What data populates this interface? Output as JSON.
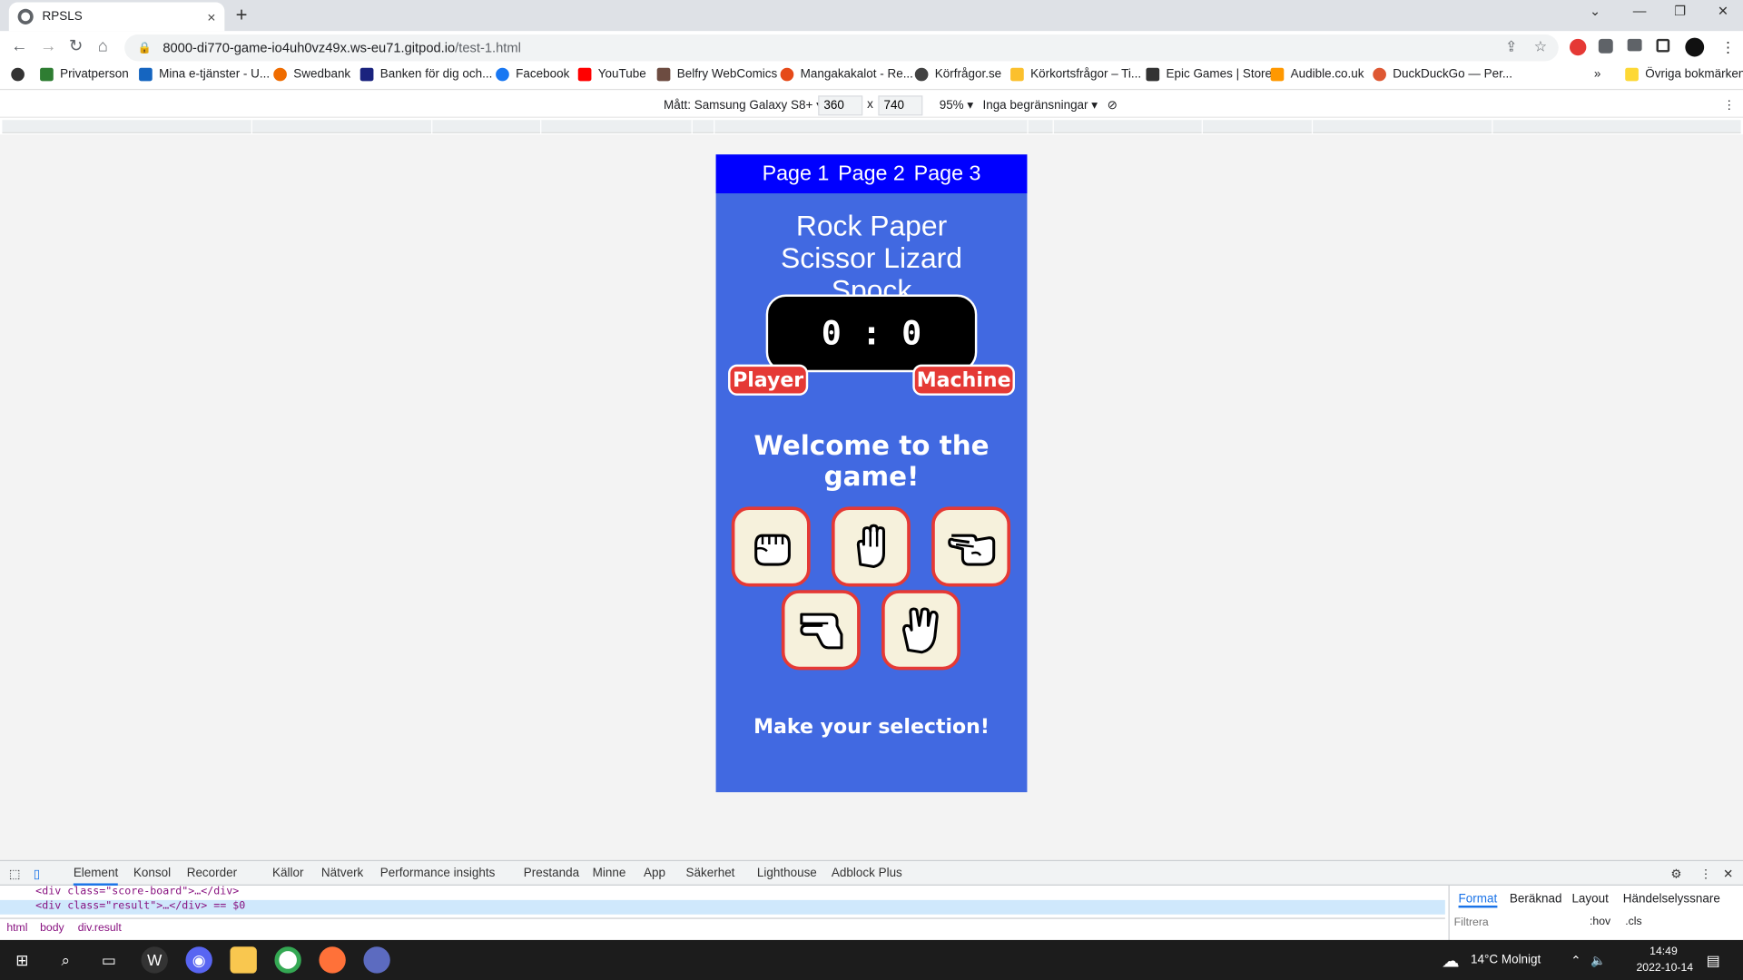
{
  "browser": {
    "tab_title": "RPSLS",
    "tab_close": "×",
    "new_tab": "+",
    "url_host": "8000-di770-game-io4uh0vz49x.ws-eu71.gitpod.io",
    "url_path": "/test-1.html"
  },
  "bookmarks": {
    "items": [
      {
        "label": "Privatperson",
        "color": "#2e7d32"
      },
      {
        "label": "Mina e-tjänster - U...",
        "color": "#1565c0"
      },
      {
        "label": "Swedbank",
        "color": "#ef6c00"
      },
      {
        "label": "Banken för dig och...",
        "color": "#1a237e"
      },
      {
        "label": "Facebook",
        "color": "#1877f2"
      },
      {
        "label": "YouTube",
        "color": "#ff0000"
      },
      {
        "label": "Belfry WebComics",
        "color": "#6d4c41"
      },
      {
        "label": "Mangakakalot - Re...",
        "color": "#e64a19"
      },
      {
        "label": "Körfrågor.se",
        "color": "#424242"
      },
      {
        "label": "Körkortsfrågor – Ti...",
        "color": "#fbc02d"
      },
      {
        "label": "Epic Games | Store",
        "color": "#333333"
      },
      {
        "label": "Audible.co.uk",
        "color": "#ff9800"
      },
      {
        "label": "DuckDuckGo — Per...",
        "color": "#de5833"
      }
    ],
    "overflow": "»",
    "other": "Övriga bokmärken"
  },
  "device_toolbar": {
    "device": "Mått: Samsung Galaxy S8+",
    "width": "360",
    "times": "x",
    "height": "740",
    "zoom": "95%",
    "throttle": "Inga begränsningar"
  },
  "game": {
    "nav": [
      "Page 1",
      "Page 2",
      "Page 3"
    ],
    "title": "Rock Paper Scissor Lizard Spock",
    "score": "0 : 0",
    "player_label": "Player",
    "machine_label": "Machine",
    "welcome": "Welcome to the game!",
    "choices": [
      "rock",
      "paper",
      "scissors",
      "lizard",
      "spock"
    ],
    "prompt": "Make your selection!",
    "colors": {
      "background": "#4169e1",
      "nav": "#0000ff",
      "accent": "#e53935",
      "card": "#f6f1dc"
    }
  },
  "devtools": {
    "tabs": [
      "Element",
      "Konsol",
      "Recorder",
      "Källor",
      "Nätverk",
      "Performance insights",
      "Prestanda",
      "Minne",
      "App",
      "Säkerhet",
      "Lighthouse",
      "Adblock Plus"
    ],
    "code_line1": "<div class=\"score-board\">…</div>",
    "code_line2": "<div class=\"result\">…</div> == $0",
    "crumbs": [
      "html",
      "body",
      "div.result"
    ],
    "side_tabs": [
      "Format",
      "Beräknad",
      "Layout",
      "Händelselyssnare"
    ],
    "filter_placeholder": "Filtrera",
    "hov": ":hov",
    "cls": ".cls"
  },
  "taskbar": {
    "weather": "14°C  Molnigt",
    "time": "14:49",
    "date": "2022-10-14"
  }
}
